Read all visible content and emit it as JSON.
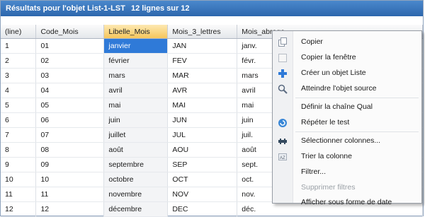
{
  "window": {
    "title": "Résultats pour l'objet List-1-LST",
    "row_count": "12 lignes sur 12"
  },
  "table": {
    "columns": [
      "(line)",
      "Code_Mois",
      "Libelle_Mois",
      "Mois_3_lettres",
      "Mois_abrege"
    ],
    "rows": [
      [
        "1",
        "01",
        "janvier",
        "JAN",
        "janv."
      ],
      [
        "2",
        "02",
        "février",
        "FEV",
        "févr."
      ],
      [
        "3",
        "03",
        "mars",
        "MAR",
        "mars"
      ],
      [
        "4",
        "04",
        "avril",
        "AVR",
        "avril"
      ],
      [
        "5",
        "05",
        "mai",
        "MAI",
        "mai"
      ],
      [
        "6",
        "06",
        "juin",
        "JUN",
        "juin"
      ],
      [
        "7",
        "07",
        "juillet",
        "JUL",
        "juil."
      ],
      [
        "8",
        "08",
        "août",
        "AOU",
        "août"
      ],
      [
        "9",
        "09",
        "septembre",
        "SEP",
        "sept."
      ],
      [
        "10",
        "10",
        "octobre",
        "OCT",
        "oct."
      ],
      [
        "11",
        "11",
        "novembre",
        "NOV",
        "nov."
      ],
      [
        "12",
        "12",
        "décembre",
        "DEC",
        "déc."
      ]
    ]
  },
  "context_menu": {
    "items": [
      {
        "label": "Copier",
        "icon": "copy-icon"
      },
      {
        "label": "Copier la fenêtre",
        "icon": "copy-window-icon"
      },
      {
        "label": "Créer un objet Liste",
        "icon": "plus-icon"
      },
      {
        "label": "Atteindre l'objet source",
        "icon": "magnifier-icon"
      },
      {
        "label": "Définir la chaîne Qual",
        "icon": ""
      },
      {
        "label": "Répéter le test",
        "icon": "refresh-icon"
      },
      {
        "label": "Sélectionner colonnes...",
        "icon": "columns-icon"
      },
      {
        "label": "Trier la colonne",
        "icon": "sort-icon"
      },
      {
        "label": "Filtrer...",
        "icon": ""
      },
      {
        "label": "Supprimer filtres",
        "icon": "",
        "disabled": true
      },
      {
        "label": "Afficher sous forme de date",
        "icon": ""
      }
    ]
  },
  "colors": {
    "title_bar": "#2d67ad",
    "selected_cell": "#2f7ad8",
    "selected_header": "#f6c65c",
    "annotation_arrow": "#d0262b"
  }
}
